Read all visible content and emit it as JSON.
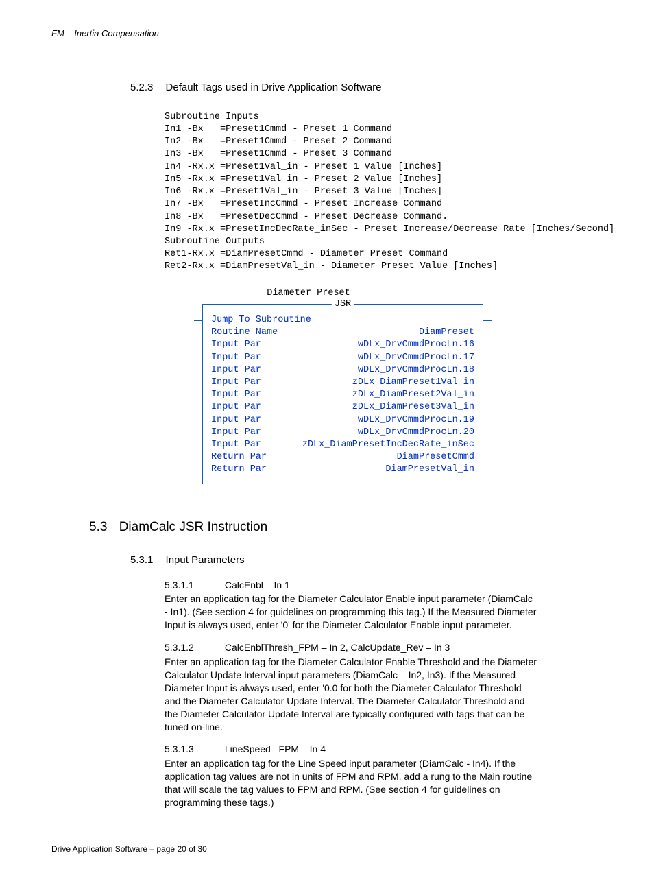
{
  "header": "FM – Inertia Compensation",
  "h523": {
    "num": "5.2.3",
    "title": "Default Tags used in Drive Application Software"
  },
  "code": "Subroutine Inputs\nIn1 -Bx   =Preset1Cmmd - Preset 1 Command\nIn2 -Bx   =Preset1Cmmd - Preset 2 Command\nIn3 -Bx   =Preset1Cmmd - Preset 3 Command\nIn4 -Rx.x =Preset1Val_in - Preset 1 Value [Inches]\nIn5 -Rx.x =Preset1Val_in - Preset 2 Value [Inches]\nIn6 -Rx.x =Preset1Val_in - Preset 3 Value [Inches]\nIn7 -Bx   =PresetIncCmmd - Preset Increase Command\nIn8 -Bx   =PresetDecCmmd - Preset Decrease Command.\nIn9 -Rx.x =PresetIncDecRate_inSec - Preset Increase/Decrease Rate [Inches/Second]\nSubroutine Outputs\nRet1-Rx.x =DiamPresetCmmd - Diameter Preset Command\nRet2-Rx.x =DiamPresetVal_in - Diameter Preset Value [Inches]",
  "diagram": {
    "title": "Diameter Preset",
    "boxlabel": "JSR",
    "rows": [
      {
        "l": "Jump To Subroutine",
        "r": ""
      },
      {
        "l": "Routine Name",
        "r": "DiamPreset"
      },
      {
        "l": "Input Par",
        "r": "wDLx_DrvCmmdProcLn.16"
      },
      {
        "l": "Input Par",
        "r": "wDLx_DrvCmmdProcLn.17"
      },
      {
        "l": "Input Par",
        "r": "wDLx_DrvCmmdProcLn.18"
      },
      {
        "l": "Input Par",
        "r": "zDLx_DiamPreset1Val_in"
      },
      {
        "l": "Input Par",
        "r": "zDLx_DiamPreset2Val_in"
      },
      {
        "l": "Input Par",
        "r": "zDLx_DiamPreset3Val_in"
      },
      {
        "l": "Input Par",
        "r": "wDLx_DrvCmmdProcLn.19"
      },
      {
        "l": "Input Par",
        "r": "wDLx_DrvCmmdProcLn.20"
      },
      {
        "l": "Input Par",
        "r": "zDLx_DiamPresetIncDecRate_inSec"
      },
      {
        "l": "Return Par",
        "r": "DiamPresetCmmd"
      },
      {
        "l": "Return Par",
        "r": "DiamPresetVal_in"
      }
    ]
  },
  "h53": {
    "num": "5.3",
    "title": "DiamCalc JSR Instruction"
  },
  "h531": {
    "num": "5.3.1",
    "title": "Input Parameters"
  },
  "s1": {
    "num": "5.3.1.1",
    "title": "CalcEnbl – In 1",
    "body": "Enter an application tag for the Diameter Calculator Enable input parameter (DiamCalc - In1).  (See section 4 for guidelines on programming this tag.)  If the Measured Diameter Input is always used, enter '0' for the Diameter Calculator Enable input parameter."
  },
  "s2": {
    "num": "5.3.1.2",
    "title": "CalcEnblThresh_FPM – In 2, CalcUpdate_Rev – In 3",
    "body": "Enter an application tag for the Diameter Calculator Enable Threshold and the Diameter Calculator Update Interval input parameters (DiamCalc – In2, In3).  If the Measured Diameter Input is always used, enter '0.0 for both the Diameter Calculator Threshold and the Diameter Calculator Update Interval.  The Diameter Calculator Threshold and the Diameter Calculator Update Interval are typically configured with tags that can be tuned on-line."
  },
  "s3": {
    "num": "5.3.1.3",
    "title": "LineSpeed _FPM – In 4",
    "body": "Enter an application tag for the Line Speed input parameter (DiamCalc - In4).  If the application tag values are not in units of FPM and RPM, add a rung to the Main routine that will scale the tag values to FPM and RPM.  (See section 4 for guidelines on programming these tags.)"
  },
  "footer": "Drive Application Software – page 20 of 30"
}
